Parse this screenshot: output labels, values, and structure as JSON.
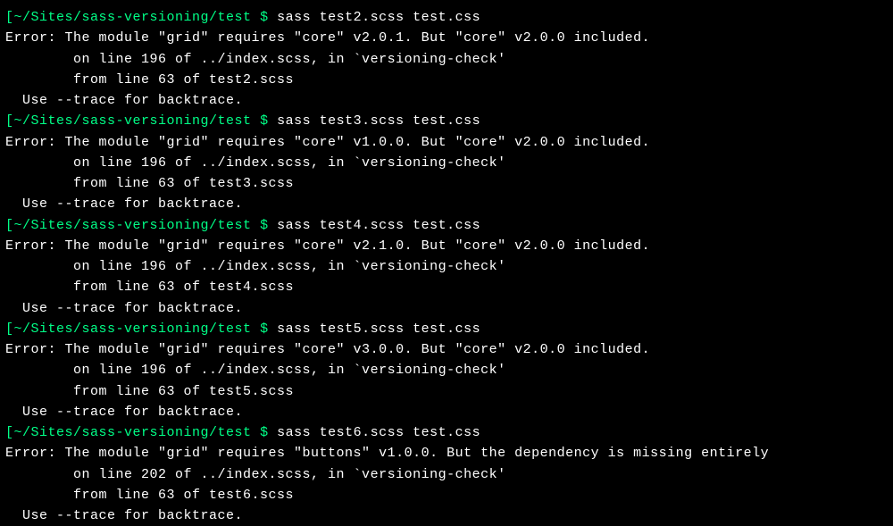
{
  "blocks": [
    {
      "prompt_bracket_open": "[",
      "prompt_path": "~/Sites/sass-versioning/test",
      "prompt_dollar": " $ ",
      "command": "sass test2.scss test.css",
      "error_line": "Error: The module \"grid\" requires \"core\" v2.0.1. But \"core\" v2.0.0 included.",
      "trace1": "        on line 196 of ../index.scss, in `versioning-check'",
      "trace2": "        from line 63 of test2.scss",
      "use_trace": "  Use --trace for backtrace."
    },
    {
      "prompt_bracket_open": "[",
      "prompt_path": "~/Sites/sass-versioning/test",
      "prompt_dollar": " $ ",
      "command": "sass test3.scss test.css",
      "error_line": "Error: The module \"grid\" requires \"core\" v1.0.0. But \"core\" v2.0.0 included.",
      "trace1": "        on line 196 of ../index.scss, in `versioning-check'",
      "trace2": "        from line 63 of test3.scss",
      "use_trace": "  Use --trace for backtrace."
    },
    {
      "prompt_bracket_open": "[",
      "prompt_path": "~/Sites/sass-versioning/test",
      "prompt_dollar": " $ ",
      "command": "sass test4.scss test.css",
      "error_line": "Error: The module \"grid\" requires \"core\" v2.1.0. But \"core\" v2.0.0 included.",
      "trace1": "        on line 196 of ../index.scss, in `versioning-check'",
      "trace2": "        from line 63 of test4.scss",
      "use_trace": "  Use --trace for backtrace."
    },
    {
      "prompt_bracket_open": "[",
      "prompt_path": "~/Sites/sass-versioning/test",
      "prompt_dollar": " $ ",
      "command": "sass test5.scss test.css",
      "error_line": "Error: The module \"grid\" requires \"core\" v3.0.0. But \"core\" v2.0.0 included.",
      "trace1": "        on line 196 of ../index.scss, in `versioning-check'",
      "trace2": "        from line 63 of test5.scss",
      "use_trace": "  Use --trace for backtrace."
    },
    {
      "prompt_bracket_open": "[",
      "prompt_path": "~/Sites/sass-versioning/test",
      "prompt_dollar": " $ ",
      "command": "sass test6.scss test.css",
      "error_line": "Error: The module \"grid\" requires \"buttons\" v1.0.0. But the dependency is missing entirely",
      "trace1": "        on line 202 of ../index.scss, in `versioning-check'",
      "trace2": "        from line 63 of test6.scss",
      "use_trace": "  Use --trace for backtrace."
    }
  ]
}
